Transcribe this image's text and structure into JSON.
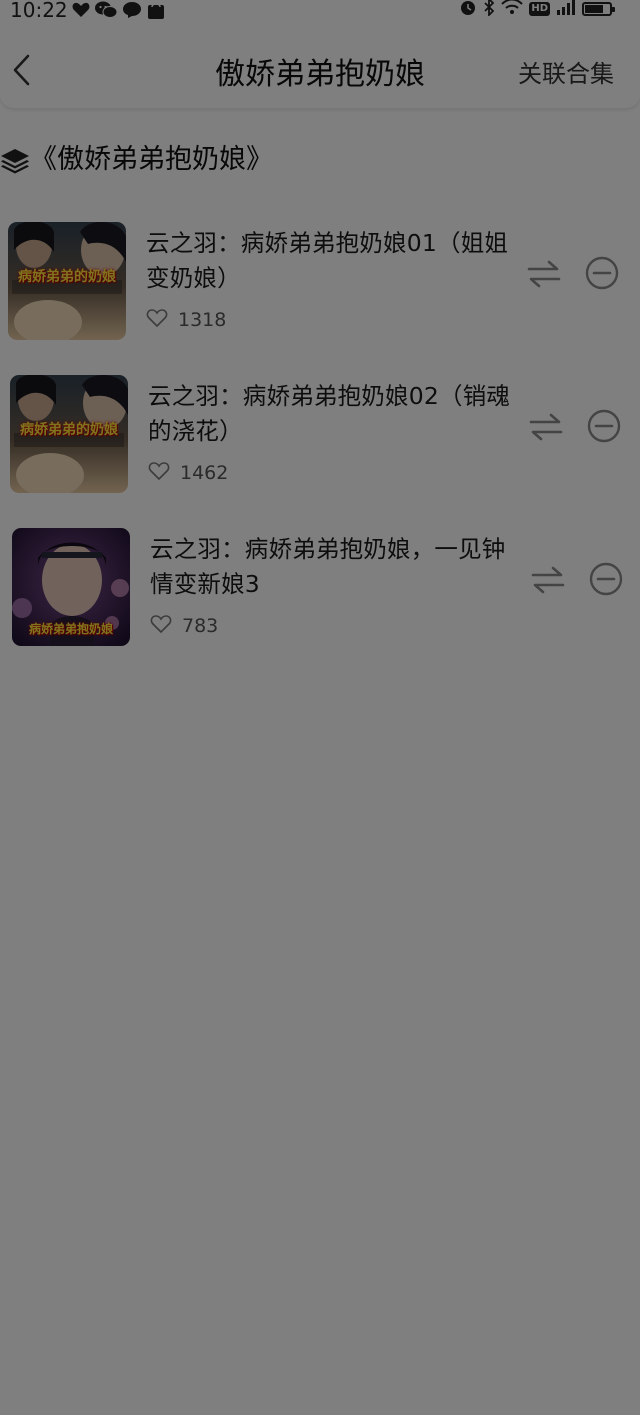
{
  "status_bar": {
    "time": "10:22",
    "icons_left": [
      "heart-icon",
      "wechat-icon",
      "chat-bubble-icon",
      "shopping-bag-icon"
    ],
    "icons_right": [
      "alarm-icon",
      "bluetooth-icon",
      "wifi-icon",
      "hd-icon",
      "signal-icon",
      "battery-icon"
    ],
    "hd_label": "HD"
  },
  "header": {
    "title": "傲娇弟弟抱奶娘",
    "action_label": "关联合集",
    "back_icon": "chevron-left-icon"
  },
  "collection": {
    "icon": "layers-icon",
    "title": "《傲娇弟弟抱奶娘》"
  },
  "episodes": [
    {
      "title": "云之羽：病娇弟弟抱奶娘01（姐姐变奶娘）",
      "likes": "1318",
      "thumb_caption": "病娇弟弟的奶娘",
      "thumb_palette": [
        "#3a4a5a",
        "#c99a6a",
        "#e9c9a0"
      ]
    },
    {
      "title": "云之羽：病娇弟弟抱奶娘02（销魂的浇花）",
      "likes": "1462",
      "thumb_caption": "病娇弟弟的奶娘",
      "thumb_palette": [
        "#3a4a5a",
        "#c99a6a",
        "#e9c9a0"
      ]
    },
    {
      "title": "云之羽：病娇弟弟抱奶娘，一见钟情变新娘3",
      "likes": "783",
      "thumb_caption": "病娇弟弟抱奶娘",
      "thumb_palette": [
        "#2a1a3a",
        "#7a4a8a",
        "#e0c0d8"
      ]
    }
  ],
  "colors": {
    "overlay": "rgba(0,0,0,0.5)",
    "text_primary": "#1a1a1a",
    "text_secondary": "#555555",
    "icon_gray": "#8a8a8a"
  }
}
